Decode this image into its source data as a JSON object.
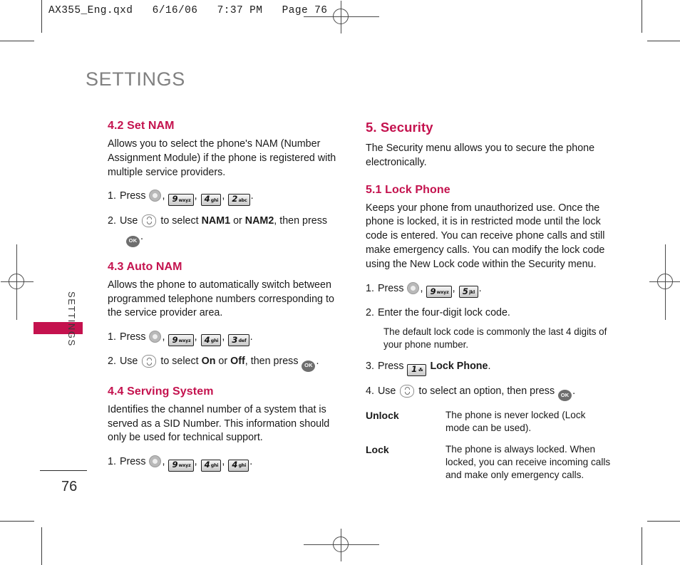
{
  "file_header": "AX355_Eng.qxd   6/16/06   7:37 PM   Page 76",
  "page": {
    "title": "SETTINGS",
    "side_tab_label": "SETTINGS",
    "number": "76"
  },
  "colors": {
    "accent": "#c4124e",
    "title_gray": "#808080",
    "body": "#1a1a1a"
  },
  "left_column": {
    "sections": [
      {
        "heading": "4.2 Set NAM",
        "body": "Allows you to select the phone's NAM (Number Assignment Module) if the phone is registered with multiple service providers.",
        "steps": [
          {
            "num": "1.",
            "parts": [
              "Press ",
              "menu-key",
              ", ",
              "key-9",
              ", ",
              "key-4",
              ", ",
              "key-2",
              "."
            ]
          },
          {
            "num": "2.",
            "parts": [
              "Use ",
              "nav-key",
              " to select ",
              "NAM1",
              " or ",
              "NAM2",
              ", then press ",
              "ok-key",
              "."
            ]
          }
        ]
      },
      {
        "heading": "4.3 Auto NAM",
        "body": "Allows the phone to automatically switch between programmed telephone numbers corresponding to the service provider area.",
        "steps": [
          {
            "num": "1.",
            "parts": [
              "Press ",
              "menu-key",
              ", ",
              "key-9",
              ", ",
              "key-4",
              ", ",
              "key-3",
              "."
            ]
          },
          {
            "num": "2.",
            "parts": [
              "Use ",
              "nav-key",
              " to select ",
              "On",
              " or ",
              "Off",
              ", then press ",
              "ok-key",
              "."
            ]
          }
        ]
      },
      {
        "heading": "4.4 Serving System",
        "body": "Identifies the channel number of a system that is served as a SID Number. This information should only be used for technical support.",
        "steps": [
          {
            "num": "1.",
            "parts": [
              "Press ",
              "menu-key",
              ", ",
              "key-9",
              ", ",
              "key-4",
              ", ",
              "key-4",
              "."
            ]
          }
        ]
      }
    ]
  },
  "right_column": {
    "section_major": {
      "heading": "5. Security",
      "body": "The Security menu allows you to secure the phone electronically."
    },
    "section_minor": {
      "heading": "5.1 Lock Phone",
      "body": "Keeps your phone from unauthorized use. Once the phone is locked, it is in restricted mode until the lock code is entered. You can receive phone calls and still make emergency calls. You can modify the lock code using the New Lock code within the Security menu."
    },
    "steps": {
      "step1_num": "1.",
      "step1_press": "Press",
      "step2_num": "2.",
      "step2_text": "Enter the four-digit lock code.",
      "step2_note": "The default lock code is commonly the last 4 digits of your phone number.",
      "step3_num": "3.",
      "step3_press": "Press",
      "step3_label": "Lock Phone",
      "step3_period": ".",
      "step4_num": "4.",
      "step4_pre": "Use",
      "step4_mid": "to select an option, then press",
      "step4_post": "."
    },
    "definitions": [
      {
        "term": "Unlock",
        "desc": "The phone is never locked (Lock mode can be used)."
      },
      {
        "term": "Lock",
        "desc": "The phone is always locked. When locked, you can receive incoming calls and make only emergency calls."
      }
    ]
  },
  "keys": {
    "key1": {
      "digit": "1",
      "sub": "☘"
    },
    "key2": {
      "digit": "2",
      "sub": "abc"
    },
    "key3": {
      "digit": "3",
      "sub": "def"
    },
    "key4": {
      "digit": "4",
      "sub": "ghi"
    },
    "key5": {
      "digit": "5",
      "sub": "jkl"
    },
    "key9": {
      "digit": "9",
      "sub": "wxyz"
    },
    "ok_label": "OK"
  },
  "phrases": {
    "press": "Press",
    "use": "Use",
    "comma": ",",
    "period": ".",
    "to_select": "to select",
    "or": "or",
    "then_press": ", then press",
    "nam1": "NAM1",
    "nam2": "NAM2",
    "on": "On",
    "off": "Off"
  }
}
